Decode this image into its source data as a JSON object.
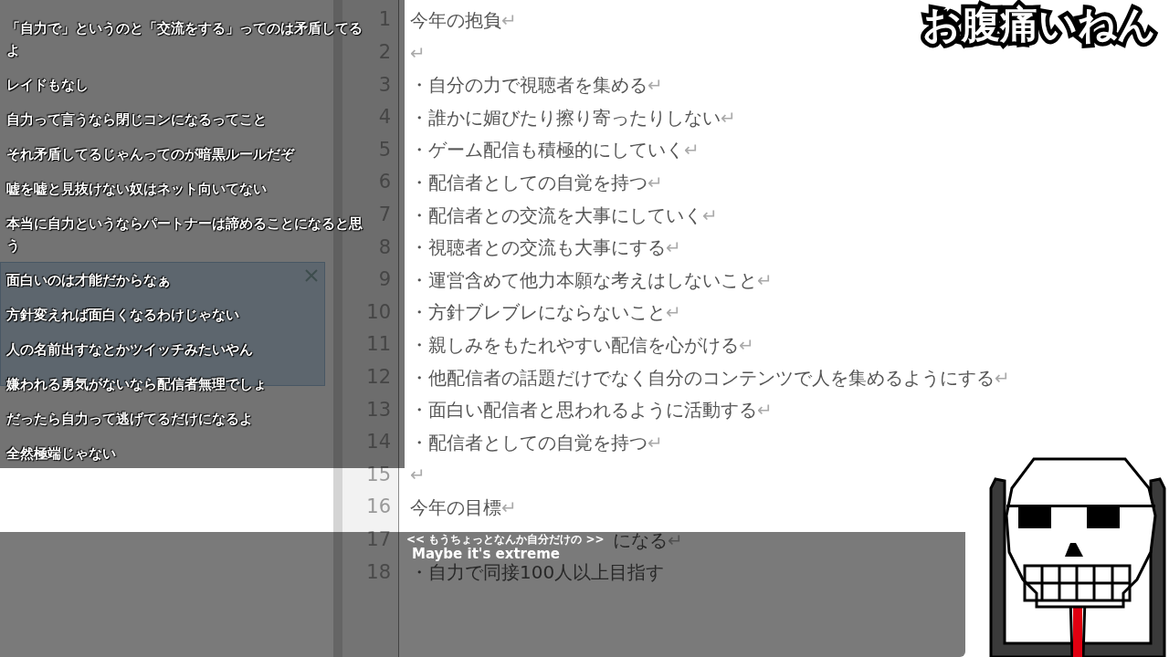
{
  "overlay_title": "お腹痛いねん",
  "editor": {
    "lines": [
      {
        "number": "1",
        "text": "今年の抱負",
        "eol": "↵"
      },
      {
        "number": "2",
        "eol": "↵"
      },
      {
        "number": "3",
        "text": "・自分の力で視聴者を集める",
        "eol": "↵"
      },
      {
        "number": "4",
        "text": "・誰かに媚びたり擦り寄ったりしない",
        "eol": "↵"
      },
      {
        "number": "5",
        "text": "・ゲーム配信も積極的にしていく",
        "eol": "↵"
      },
      {
        "number": "6",
        "text": "・配信者としての自覚を持つ",
        "eol": "↵"
      },
      {
        "number": "7",
        "text": "・配信者との交流を大事にしていく",
        "eol": "↵"
      },
      {
        "number": "8",
        "text": "・視聴者との交流も大事にする",
        "eol": "↵"
      },
      {
        "number": "9",
        "text": "・運営含めて他力本願な考えはしないこと",
        "eol": "↵"
      },
      {
        "number": "10",
        "text": "・方針ブレブレにならないこと",
        "eol": "↵"
      },
      {
        "number": "11",
        "text": "・親しみをもたれやすい配信を心がける",
        "eol": "↵"
      },
      {
        "number": "12",
        "text": "・他配信者の話題だけでなく自分のコンテンツで人を集めるようにする",
        "eol": "↵"
      },
      {
        "number": "13",
        "text": "・面白い配信者と思われるように活動する",
        "eol": "↵"
      },
      {
        "number": "14",
        "text": "・配信者としての自覚を持つ",
        "eol": "↵"
      },
      {
        "number": "15",
        "eol": "↵"
      },
      {
        "number": "16",
        "text": "今年の目標",
        "eol": "↵"
      },
      {
        "number": "17",
        "text": "になる",
        "eol": "↵",
        "covered": true
      },
      {
        "number": "18",
        "text": "・自力で同接100人以上目指す"
      }
    ]
  },
  "chat": [
    "「自力で」というのと「交流をする」ってのは矛盾してるよ",
    "レイドもなし",
    "自力って言うなら閉じコンになるってこと",
    "それ矛盾してるじゃんってのが暗黒ルールだぞ",
    "嘘を嘘と見抜けない奴はネット向いてない",
    "本当に自力というならパートナーは諦めることになると思う",
    "面白いのは才能だからなぁ",
    "方針変えれば面白くなるわけじゃない",
    "人の名前出すなとかツイッチみたいやん",
    "嫌われる勇気がないなら配信者無理でしょ",
    "だったら自力って逃げてるだけになるよ",
    "全然極端じゃない"
  ],
  "subtitle": {
    "original": "<< もうちょっとなんか自分だけの >>",
    "translation": "Maybe it's extreme"
  }
}
